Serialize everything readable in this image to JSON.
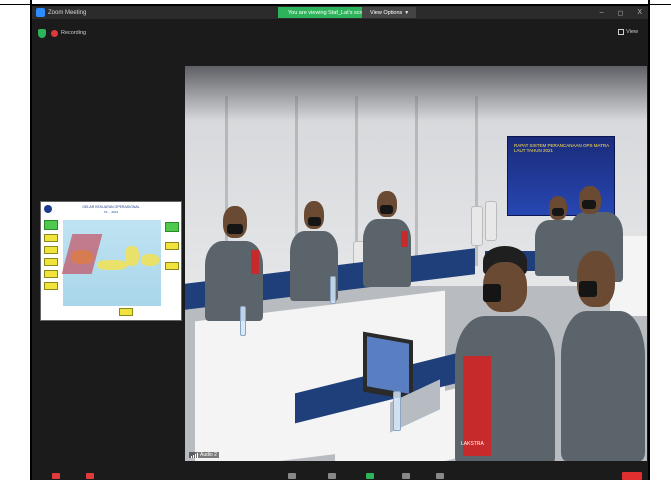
{
  "window": {
    "title": "Zoom Meeting",
    "minimize": "–",
    "maximize": "◻",
    "close": "X"
  },
  "share_banner": {
    "text": "You are viewing Staf_Lat's screen",
    "view_options_label": "View Options",
    "view_options_caret": "▾"
  },
  "recording": {
    "label": "Recording"
  },
  "view_button": {
    "label": "View"
  },
  "slide": {
    "title": "GELAR KEKUATAN OPERASIONAL",
    "subtitle": "TA ... 2021"
  },
  "video": {
    "banner_text": "RAPAT SISTEM PERANCANAAN OPS MATRA LAUT TAHUN 2021",
    "participant_name": "Audio 2",
    "patch_text": "LAKSTRA"
  },
  "colors": {
    "share_green": "#2db35a",
    "record_red": "#e03a3a",
    "end_red": "#e02f2f",
    "uniform": "#5a646a",
    "table_blue": "#1f3f7a"
  },
  "icons": {
    "app": "zoom-app-icon",
    "shield": "shield-icon",
    "record": "record-dot-icon",
    "view": "grid-view-icon",
    "signal": "signal-bars-icon"
  }
}
